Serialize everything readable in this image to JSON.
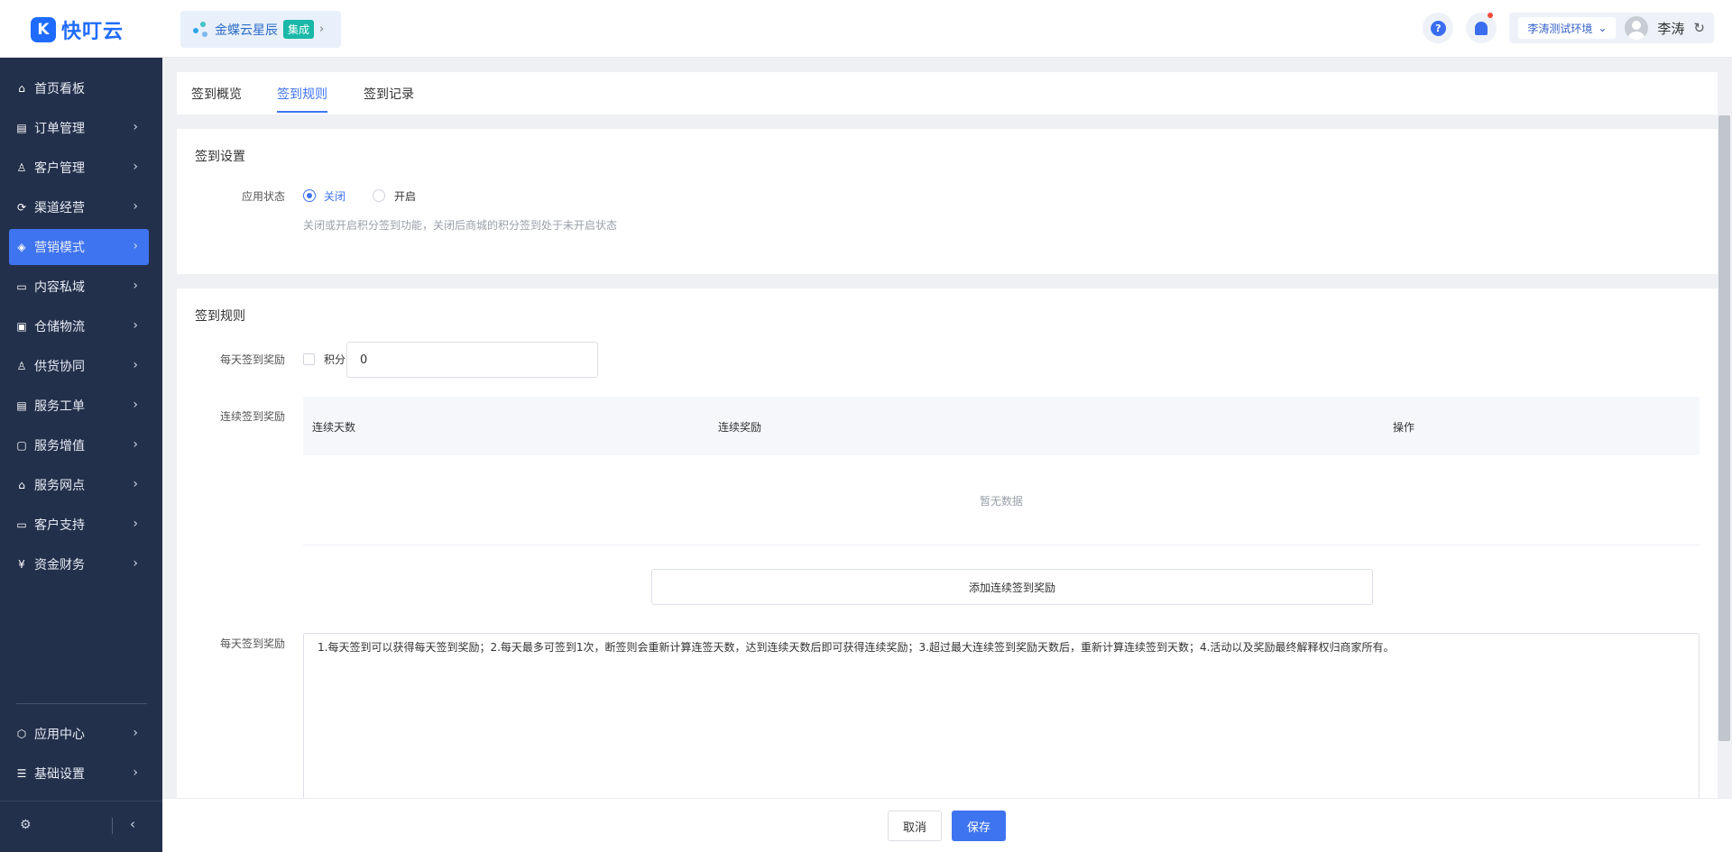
{
  "app": {
    "logo_letter": "K",
    "name": "快叮云"
  },
  "integration": {
    "name": "金蝶云星辰",
    "badge": "集成"
  },
  "topbar": {
    "help_icon": "question-circle-icon",
    "bell_icon": "bell-icon",
    "environment": "李涛测试环境",
    "user_name": "李涛",
    "refresh_icon": "refresh-icon"
  },
  "sidebar": {
    "items": [
      {
        "label": "首页看板",
        "icon": "home-icon",
        "glyph": "⌂",
        "has_arrow": false
      },
      {
        "label": "订单管理",
        "icon": "order-icon",
        "glyph": "▤",
        "has_arrow": true
      },
      {
        "label": "客户管理",
        "icon": "user-icon",
        "glyph": "♙",
        "has_arrow": true
      },
      {
        "label": "渠道经营",
        "icon": "channel-icon",
        "glyph": "⟳",
        "has_arrow": true
      },
      {
        "label": "营销模式",
        "icon": "tag-icon",
        "glyph": "◈",
        "has_arrow": true,
        "active": true
      },
      {
        "label": "内容私域",
        "icon": "image-icon",
        "glyph": "▭",
        "has_arrow": true
      },
      {
        "label": "仓储物流",
        "icon": "box-icon",
        "glyph": "▣",
        "has_arrow": true
      },
      {
        "label": "供货协同",
        "icon": "supply-icon",
        "glyph": "♙",
        "has_arrow": true
      },
      {
        "label": "服务工单",
        "icon": "ticket-icon",
        "glyph": "▤",
        "has_arrow": true
      },
      {
        "label": "服务增值",
        "icon": "bag-icon",
        "glyph": "▢",
        "has_arrow": true
      },
      {
        "label": "服务网点",
        "icon": "store-icon",
        "glyph": "⌂",
        "has_arrow": true
      },
      {
        "label": "客户支持",
        "icon": "support-icon",
        "glyph": "▭",
        "has_arrow": true
      },
      {
        "label": "资金财务",
        "icon": "yuan-icon",
        "glyph": "¥",
        "has_arrow": true
      }
    ],
    "bottom_items": [
      {
        "label": "应用中心",
        "icon": "cube-icon",
        "glyph": "⬡",
        "has_arrow": true
      },
      {
        "label": "基础设置",
        "icon": "sliders-icon",
        "glyph": "☰",
        "has_arrow": true
      }
    ],
    "footer_icon": "settings-icon",
    "collapse_icon": "collapse-left-icon"
  },
  "tabs": [
    {
      "label": "签到概览",
      "active": false
    },
    {
      "label": "签到规则",
      "active": true
    },
    {
      "label": "签到记录",
      "active": false
    }
  ],
  "settings": {
    "title": "签到设置",
    "status_label": "应用状态",
    "options": [
      {
        "label": "关闭",
        "selected": true
      },
      {
        "label": "开启",
        "selected": false
      }
    ],
    "hint": "关闭或开启积分签到功能，关闭后商城的积分签到处于未开启状态"
  },
  "rules": {
    "title": "签到规则",
    "daily_label": "每天签到奖励",
    "points_label": "积分",
    "points_checked": false,
    "points_value": "0",
    "streak_label": "连续签到奖励",
    "table_headers": [
      "连续天数",
      "连续奖励",
      "操作"
    ],
    "empty_text": "暂无数据",
    "add_button": "添加连续签到奖励",
    "description_label": "每天签到奖励",
    "description": "1.每天签到可以获得每天签到奖励；2.每天最多可签到1次，断签则会重新计算连签天数，达到连续天数后即可获得连续奖励；3.超过最大连续签到奖励天数后，重新计算连续签到天数；4.活动以及奖励最终解释权归商家所有。"
  },
  "footer": {
    "cancel": "取消",
    "save": "保存"
  },
  "colors": {
    "accent": "#3f74f0",
    "sidebar_bg": "#23304c",
    "brand": "#1f6bff"
  }
}
